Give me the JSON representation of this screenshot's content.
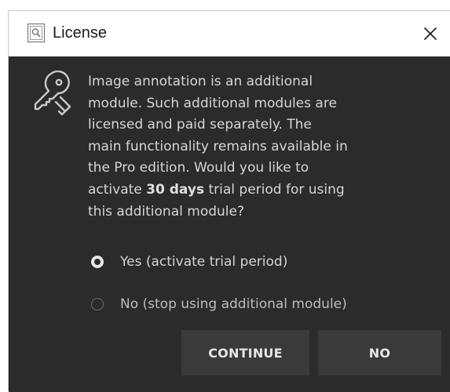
{
  "window": {
    "title": "License",
    "icons": {
      "app": "license-window-icon",
      "close": "close-icon",
      "key": "key-icon"
    }
  },
  "message": {
    "line_1": "Image annotation is an additional",
    "line_2": "module. Such additional modules are",
    "line_3": "licensed and paid separately. The",
    "line_4": "main functionality remains available in",
    "line_5": "the Pro edition. Would you like to",
    "line_6_prefix": "activate ",
    "line_6_bold": "30 days",
    "line_6_suffix": " trial period for using",
    "line_7": "this additional module?"
  },
  "options": [
    {
      "label": "Yes (activate trial period)",
      "selected": true
    },
    {
      "label": "No (stop using additional module)",
      "selected": false
    }
  ],
  "buttons": {
    "continue_label": "CONTINUE",
    "no_label": "NO"
  },
  "colors": {
    "background": "#2b2b2b",
    "titlebar": "#ffffff",
    "text": "#d6d6d6",
    "button": "#3a3a3a"
  }
}
